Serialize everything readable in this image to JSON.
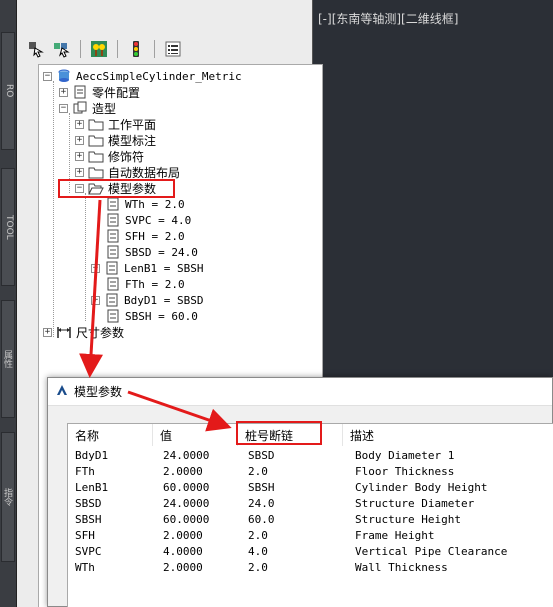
{
  "side_tabs": [
    "RO",
    "TOOL",
    "属性",
    "指令"
  ],
  "viewport": {
    "title": "[-][东南等轴测][二维线框]"
  },
  "toolbar": {
    "buttons": [
      "assembly-icon",
      "assembly-cursor-icon",
      "tree-icon",
      "traffic-light-icon",
      "list-icon"
    ]
  },
  "tree": {
    "root": "AeccSimpleCylinder_Metric",
    "part_config": "零件配置",
    "modeling": "造型",
    "work_plane": "工作平面",
    "model_dimension": "模型标注",
    "modifier": "修饰符",
    "auto_layout": "自动数据布局",
    "model_params": "模型参数",
    "params": [
      "WTh = 2.0",
      "SVPC = 4.0",
      "SFH = 2.0",
      "SBSD = 24.0",
      "LenB1 = SBSH",
      "FTh = 2.0",
      "BdyD1 = SBSD",
      "SBSH = 60.0"
    ],
    "size_params": "尺寸参数"
  },
  "dialog": {
    "title": "模型参数",
    "columns": [
      "名称",
      "值",
      "桩号断链",
      "描述"
    ],
    "rows": [
      [
        "BdyD1",
        "24.0000",
        "SBSD",
        "Body Diameter  1"
      ],
      [
        "FTh",
        "2.0000",
        "2.0",
        "Floor Thickness"
      ],
      [
        "LenB1",
        "60.0000",
        "SBSH",
        "Cylinder Body Height"
      ],
      [
        "SBSD",
        "24.0000",
        "24.0",
        "Structure Diameter"
      ],
      [
        "SBSH",
        "60.0000",
        "60.0",
        "Structure Height"
      ],
      [
        "SFH",
        "2.0000",
        "2.0",
        "Frame Height"
      ],
      [
        "SVPC",
        "4.0000",
        "4.0",
        "Vertical Pipe Clearance"
      ],
      [
        "WTh",
        "2.0000",
        "2.0",
        "Wall Thickness"
      ]
    ]
  },
  "colors": {
    "annotation": "#e31a1a",
    "dark_bg": "#2b2f36",
    "panel_bg": "#ececec"
  }
}
